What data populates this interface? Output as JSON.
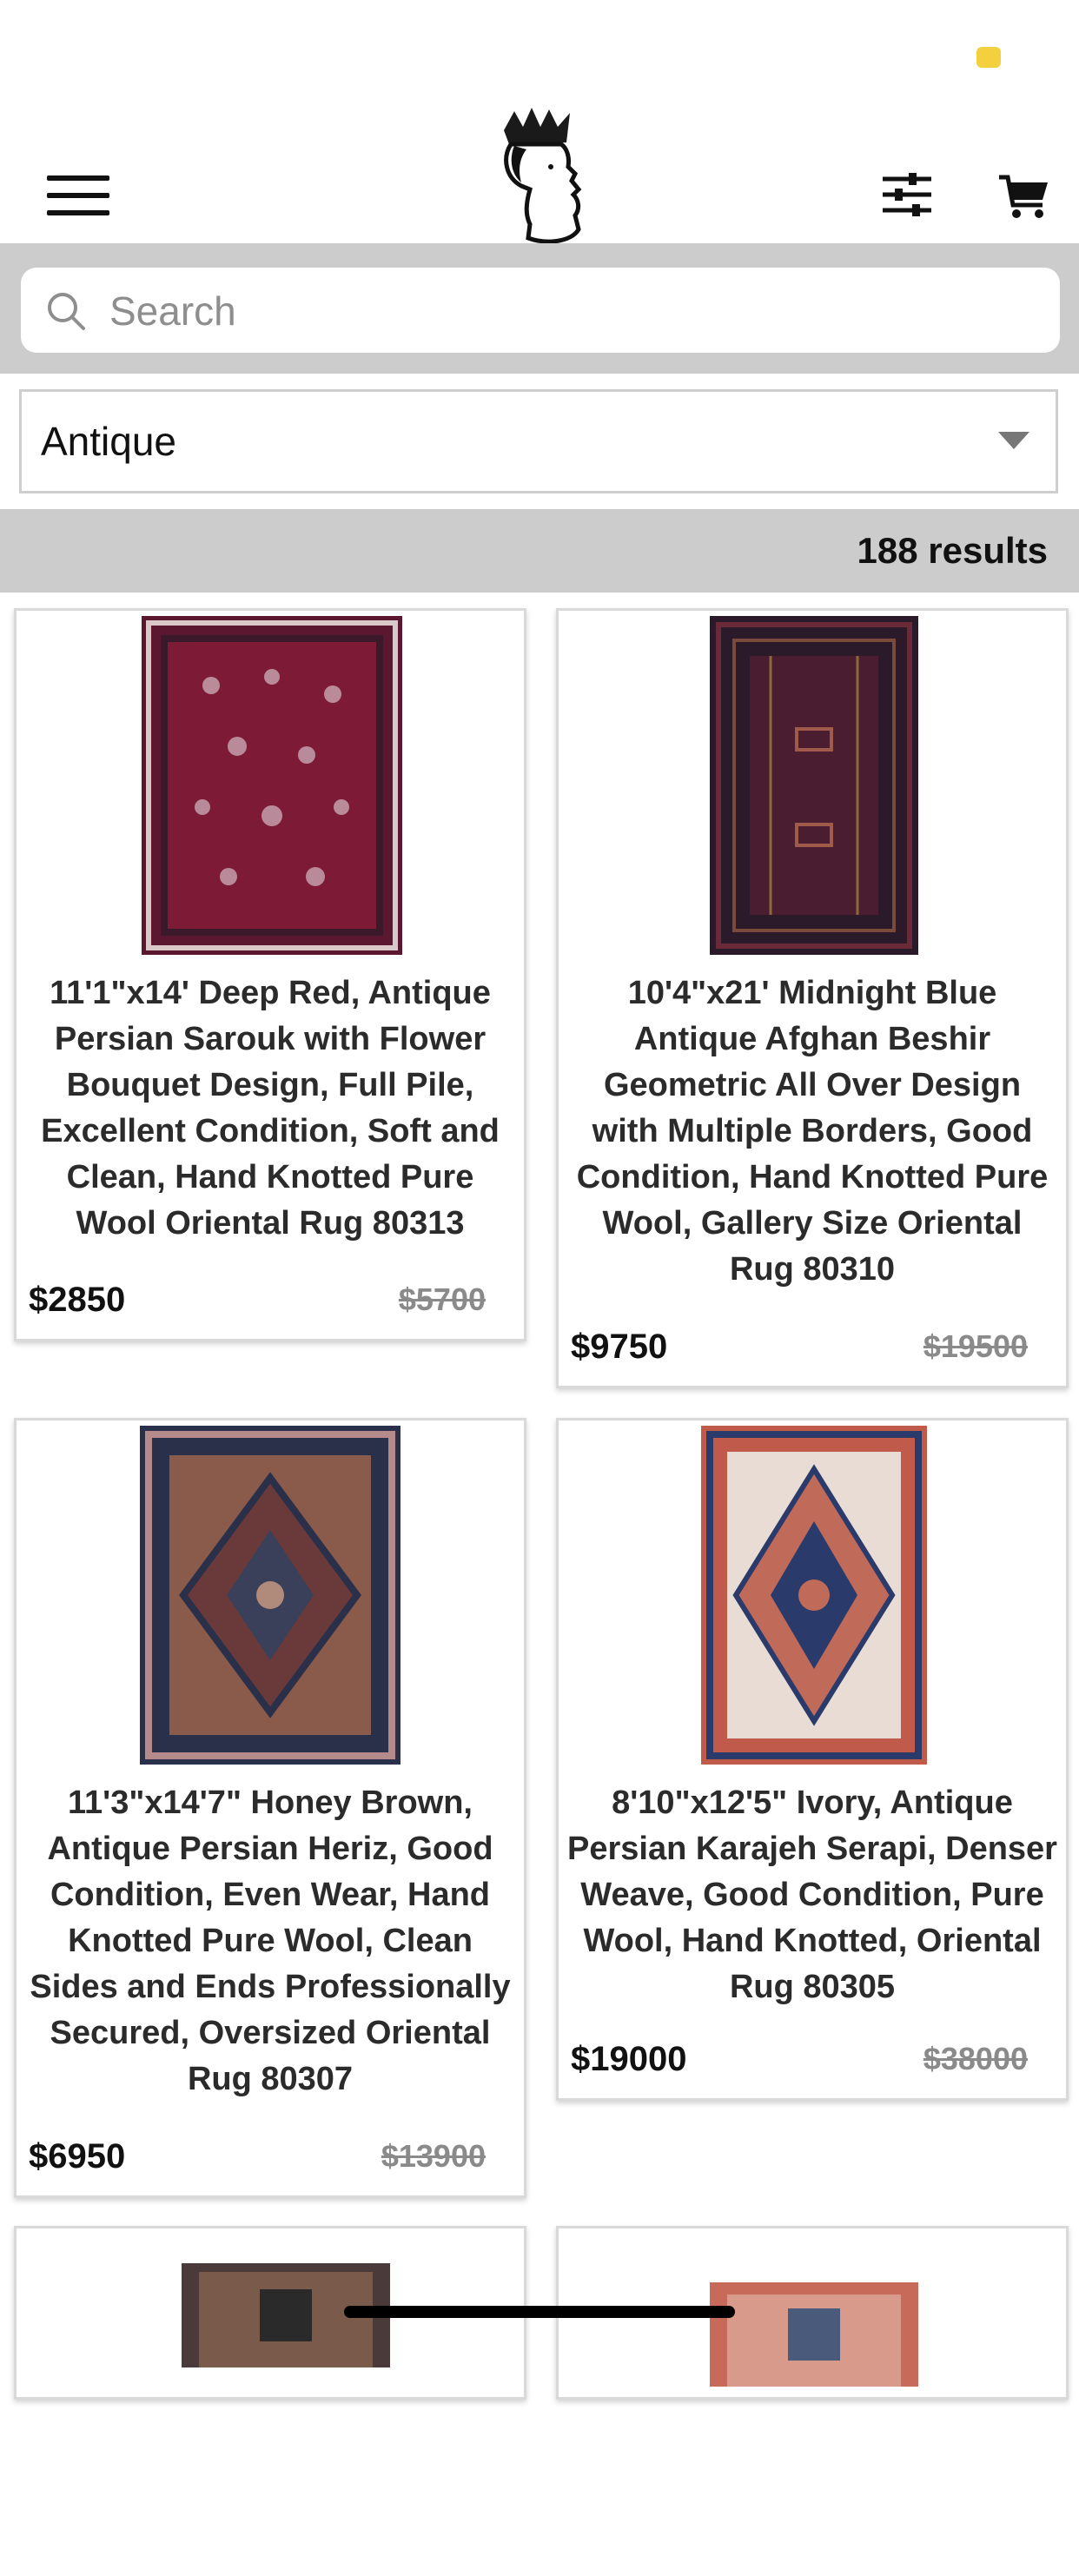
{
  "colors": {
    "accent_status": "#f4d03f",
    "band": "#cccccc"
  },
  "header": {
    "menu_icon": "hamburger-icon",
    "logo_icon": "crowned-head-logo",
    "filter_icon": "sliders-icon",
    "cart_icon": "cart-icon"
  },
  "search": {
    "placeholder": "Search",
    "value": ""
  },
  "category": {
    "selected": "Antique"
  },
  "results": {
    "count_label": "188 results"
  },
  "products": [
    {
      "title": "11'1\"x14' Deep Red, Antique Persian Sarouk with Flower Bouquet Design, Full Pile, Excellent Condition, Soft and Clean, Hand Knotted Pure Wool Oriental Rug 80313",
      "price": "$2850",
      "old_price": "$5700"
    },
    {
      "title": "10'4\"x21' Midnight Blue Antique Afghan Beshir Geometric All Over Design with Multiple Borders, Good Condition, Hand Knotted Pure Wool, Gallery Size Oriental Rug 80310",
      "price": "$9750",
      "old_price": "$19500"
    },
    {
      "title": "11'3\"x14'7\" Honey Brown, Antique Persian Heriz, Good Condition, Even Wear, Hand Knotted Pure Wool, Clean Sides and Ends Professionally Secured, Oversized Oriental Rug 80307",
      "price": "$6950",
      "old_price": "$13900"
    },
    {
      "title": "8'10\"x12'5\" Ivory, Antique Persian Karajeh Serapi, Denser Weave, Good Condition, Pure Wool, Hand Knotted, Oriental Rug 80305",
      "price": "$19000",
      "old_price": "$38000"
    }
  ]
}
